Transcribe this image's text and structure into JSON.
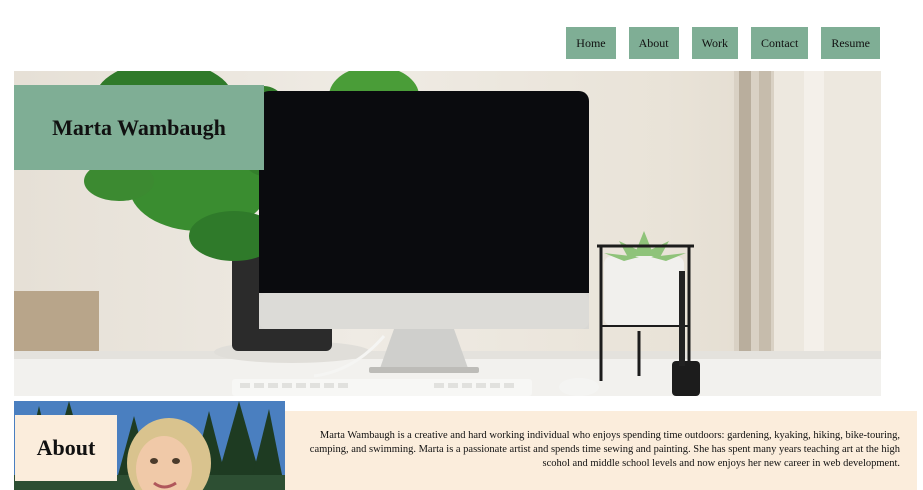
{
  "nav": {
    "items": [
      {
        "label": "Home"
      },
      {
        "label": "About"
      },
      {
        "label": "Work"
      },
      {
        "label": "Contact"
      },
      {
        "label": "Resume"
      }
    ]
  },
  "hero": {
    "name": "Marta Wambaugh"
  },
  "about": {
    "heading": "About",
    "text": "Marta Wambaugh is a creative and hard working individual who enjoys spending time outdoors: gardening, kyaking, hiking, bike-touring, camping, and swimming. Marta is a passionate artist and spends time sewing and painting. She has spent many years teaching art at the high scohol and middle school levels and now enjoys her new career in web development."
  },
  "colors": {
    "accent_green": "#7fae95",
    "cream": "#fbeddc"
  }
}
